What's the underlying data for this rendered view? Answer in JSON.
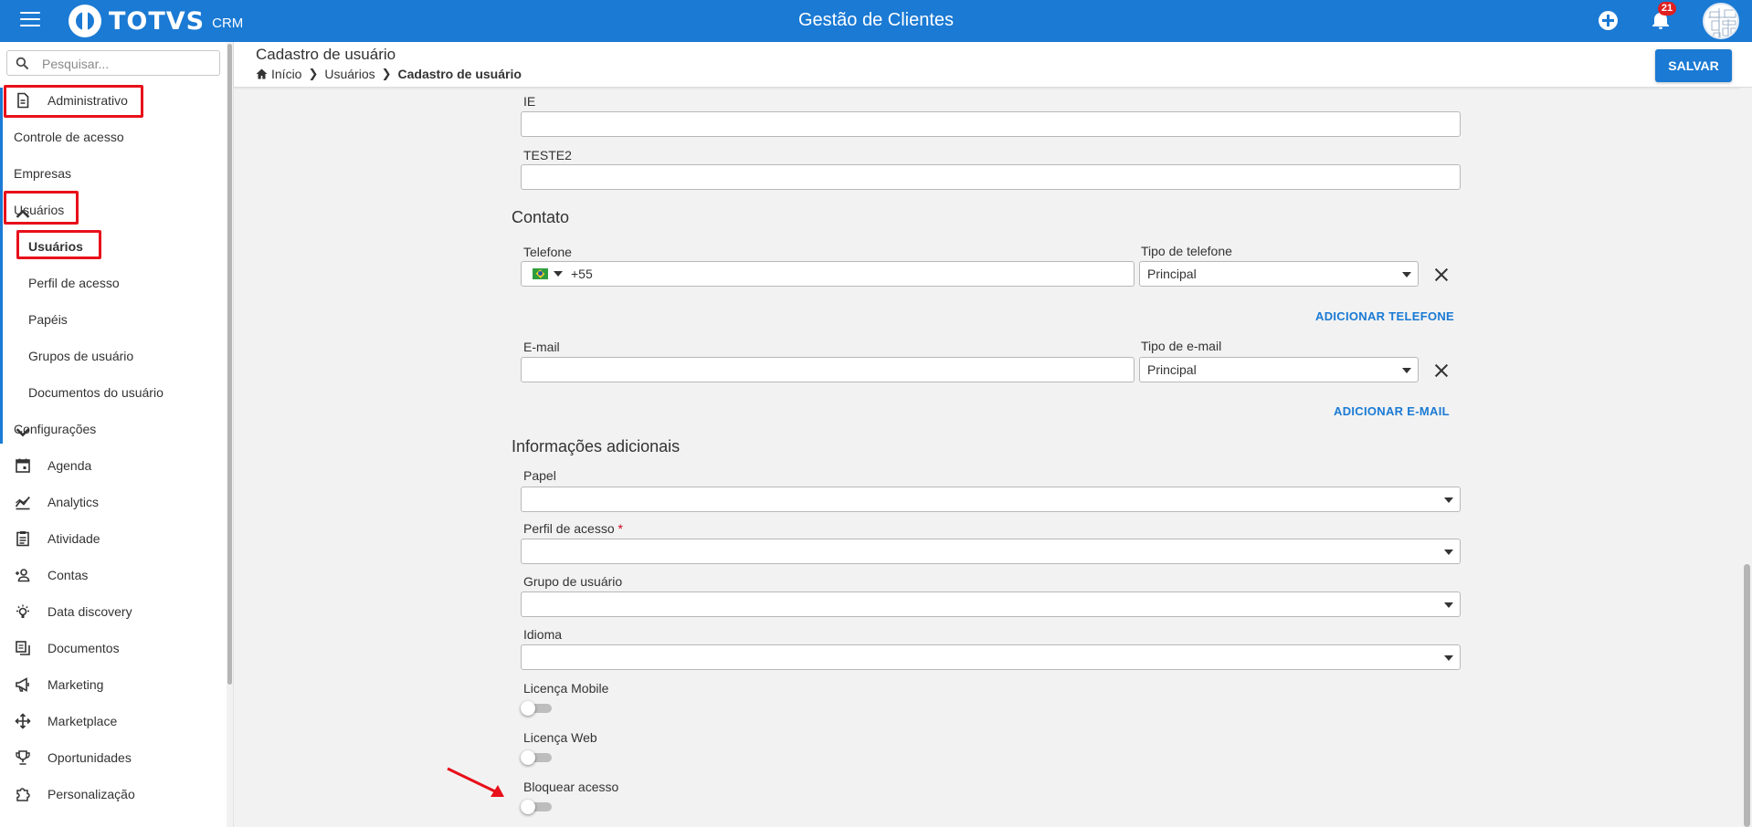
{
  "header": {
    "brand": "TOTVS",
    "brand_sub": "CRM",
    "app_title": "Gestão de Clientes",
    "notification_count": "21"
  },
  "sidebar": {
    "search_placeholder": "Pesquisar...",
    "items": [
      {
        "label": "Administrativo",
        "icon": "document-icon"
      },
      {
        "label": "Controle de acesso"
      },
      {
        "label": "Empresas"
      },
      {
        "label": "Usuários",
        "expanded": true
      },
      {
        "label": "Usuários",
        "active": true
      },
      {
        "label": "Perfil de acesso"
      },
      {
        "label": "Papéis"
      },
      {
        "label": "Grupos de usuário"
      },
      {
        "label": "Documentos do usuário"
      },
      {
        "label": "Configurações",
        "expanded": false
      },
      {
        "label": "Agenda",
        "icon": "calendar-icon"
      },
      {
        "label": "Analytics",
        "icon": "chart-icon"
      },
      {
        "label": "Atividade",
        "icon": "clipboard-icon"
      },
      {
        "label": "Contas",
        "icon": "people-icon"
      },
      {
        "label": "Data discovery",
        "icon": "bulb-icon"
      },
      {
        "label": "Documentos",
        "icon": "documents-icon"
      },
      {
        "label": "Marketing",
        "icon": "megaphone-icon"
      },
      {
        "label": "Marketplace",
        "icon": "move-icon"
      },
      {
        "label": "Oportunidades",
        "icon": "trophy-icon"
      },
      {
        "label": "Personalização",
        "icon": "puzzle-icon"
      }
    ]
  },
  "page": {
    "title": "Cadastro de usuário",
    "breadcrumb": [
      "Início",
      "Usuários",
      "Cadastro de usuário"
    ],
    "save_label": "SALVAR"
  },
  "form": {
    "ie_label": "IE",
    "ie_value": "",
    "teste2_label": "TESTE2",
    "teste2_value": "",
    "contato_title": "Contato",
    "telefone_label": "Telefone",
    "telefone_prefix": "+55",
    "tipo_telefone_label": "Tipo de telefone",
    "tipo_telefone_value": "Principal",
    "add_phone_label": "ADICIONAR TELEFONE",
    "email_label": "E-mail",
    "email_value": "",
    "tipo_email_label": "Tipo de e-mail",
    "tipo_email_value": "Principal",
    "add_email_label": "ADICIONAR E-MAIL",
    "info_title": "Informações adicionais",
    "papel_label": "Papel",
    "perfil_label": "Perfil de acesso",
    "perfil_required": "*",
    "grupo_label": "Grupo de usuário",
    "idioma_label": "Idioma",
    "licenca_mobile_label": "Licença Mobile",
    "licenca_mobile_on": false,
    "licenca_web_label": "Licença Web",
    "licenca_web_on": false,
    "bloquear_label": "Bloquear acesso",
    "bloquear_on": false
  },
  "colors": {
    "primary": "#1a7ad4",
    "highlight": "#e8101a",
    "background": "#f2f2f2"
  }
}
